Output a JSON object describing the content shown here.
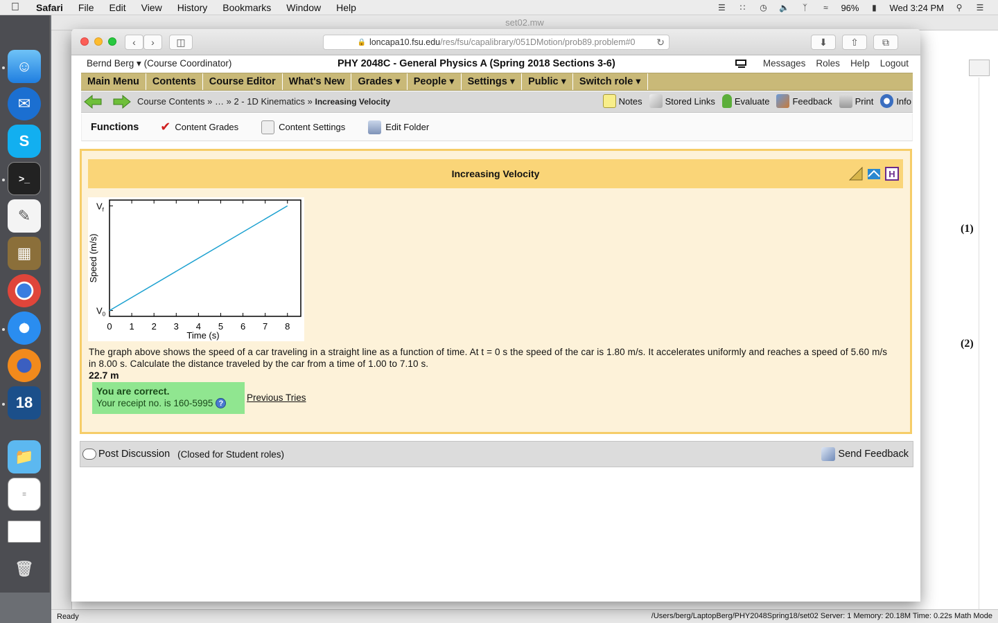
{
  "menubar": {
    "app": "Safari",
    "items": [
      "File",
      "Edit",
      "View",
      "History",
      "Bookmarks",
      "Window",
      "Help"
    ],
    "battery": "96%",
    "clock": "Wed 3:24 PM"
  },
  "maple": {
    "title": "set02.mw",
    "eq1": "(1)",
    "eq2": "(2)",
    "status_left": "Ready",
    "status_right": "/Users/berg/LaptopBerg/PHY2048Spring18/set02   Server: 1   Memory: 20.18M   Time: 0.22s   Math Mode"
  },
  "safari": {
    "url_host": "loncapa10.fsu.edu",
    "url_path": "/res/fsu/capalibrary/051DMotion/prob89.problem#0"
  },
  "page": {
    "user": "Bernd Berg ▾ (Course Coordinator)",
    "course": "PHY 2048C - General Physics A (Spring 2018 Sections 3-6)",
    "top_links": [
      "Messages",
      "Roles",
      "Help",
      "Logout"
    ],
    "main_menu": [
      "Main Menu",
      "Contents",
      "Course Editor",
      "What's New",
      "Grades ▾",
      "People ▾",
      "Settings ▾",
      "Public ▾",
      "Switch role ▾"
    ],
    "breadcrumb": {
      "prefix": "Course Contents » … » 2 - 1D Kinematics » ",
      "current": "Increasing Velocity"
    },
    "tools": [
      "Notes",
      "Stored Links",
      "Evaluate",
      "Feedback",
      "Print",
      "Info"
    ],
    "functions": {
      "title": "Functions",
      "items": [
        "Content Grades",
        "Content Settings",
        "Edit Folder"
      ]
    },
    "problem": {
      "title": "Increasing Velocity",
      "text": "The graph above shows the speed of a car traveling in a straight line as a function of time. At t = 0 s the speed of the car is 1.80 m/s. It accelerates uniformly and reaches a speed of 5.60 m/s in 8.00 s. Calculate the distance traveled by the car from a time of 1.00 to 7.10 s.",
      "answer": "22.7 m",
      "correct": "You are correct.",
      "receipt": "Your receipt no. is 160-5995",
      "previous_tries": "Previous Tries"
    },
    "discussion": {
      "post": "Post Discussion",
      "closed": "(Closed for Student roles)",
      "send": "Send Feedback"
    }
  },
  "chart_data": {
    "type": "line",
    "xlabel": "Time (s)",
    "ylabel": "Speed (m/s)",
    "x_ticks": [
      "0",
      "1",
      "2",
      "3",
      "4",
      "5",
      "6",
      "7",
      "8"
    ],
    "y_tick_labels": [
      "V0",
      "Vf"
    ],
    "xlim": [
      0,
      8.6
    ],
    "ylim": [
      0,
      1
    ],
    "series": [
      {
        "x": [
          0,
          8
        ],
        "y": [
          0.05,
          0.95
        ],
        "color": "#1aa0d0"
      }
    ]
  }
}
